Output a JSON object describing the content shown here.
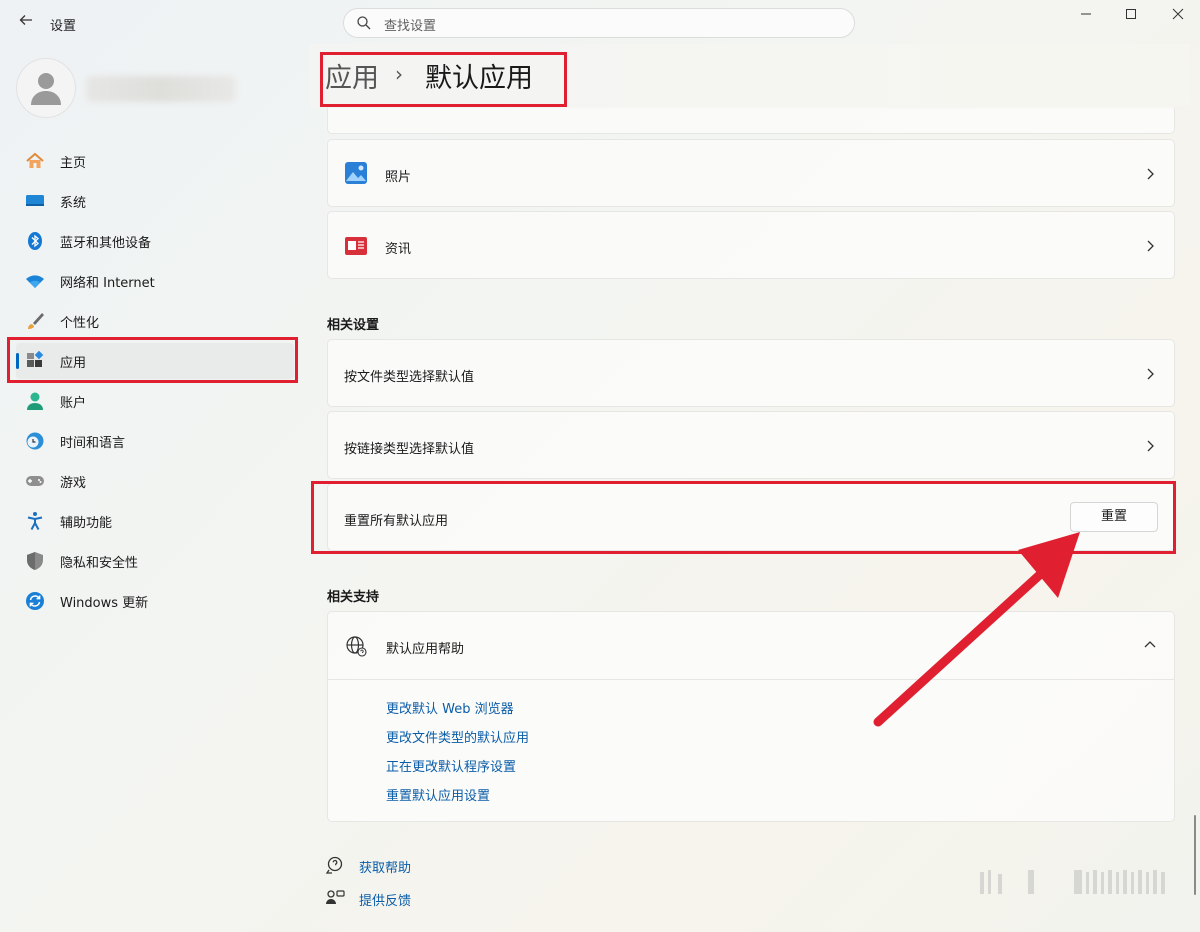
{
  "window": {
    "title": "设置",
    "search_placeholder": "查找设置"
  },
  "user": {
    "avatar_icon": "person-icon"
  },
  "sidebar": {
    "items": [
      {
        "label": "主页",
        "icon": "home-icon"
      },
      {
        "label": "系统",
        "icon": "system-icon"
      },
      {
        "label": "蓝牙和其他设备",
        "icon": "bluetooth-icon"
      },
      {
        "label": "网络和 Internet",
        "icon": "wifi-icon"
      },
      {
        "label": "个性化",
        "icon": "brush-icon"
      },
      {
        "label": "应用",
        "icon": "apps-icon",
        "selected": true
      },
      {
        "label": "账户",
        "icon": "account-icon"
      },
      {
        "label": "时间和语言",
        "icon": "clock-globe-icon"
      },
      {
        "label": "游戏",
        "icon": "gamepad-icon"
      },
      {
        "label": "辅助功能",
        "icon": "accessibility-icon"
      },
      {
        "label": "隐私和安全性",
        "icon": "shield-icon"
      },
      {
        "label": "Windows 更新",
        "icon": "update-icon"
      }
    ]
  },
  "breadcrumb": {
    "parent": "应用",
    "separator": "›",
    "current": "默认应用"
  },
  "apps": [
    {
      "label": "照片",
      "icon": "photos-icon"
    },
    {
      "label": "资讯",
      "icon": "news-icon"
    }
  ],
  "related_settings": {
    "heading": "相关设置",
    "items": [
      {
        "label": "按文件类型选择默认值"
      },
      {
        "label": "按链接类型选择默认值"
      }
    ],
    "reset": {
      "label": "重置所有默认应用",
      "button": "重置"
    }
  },
  "related_support": {
    "heading": "相关支持",
    "help_title": "默认应用帮助",
    "links": [
      "更改默认 Web 浏览器",
      "更改文件类型的默认应用",
      "正在更改默认程序设置",
      "重置默认应用设置"
    ]
  },
  "footer": {
    "get_help": "获取帮助",
    "feedback": "提供反馈"
  },
  "colors": {
    "accent": "#0067c0",
    "annotation_red": "#e02030",
    "link": "#0a5ca8"
  }
}
